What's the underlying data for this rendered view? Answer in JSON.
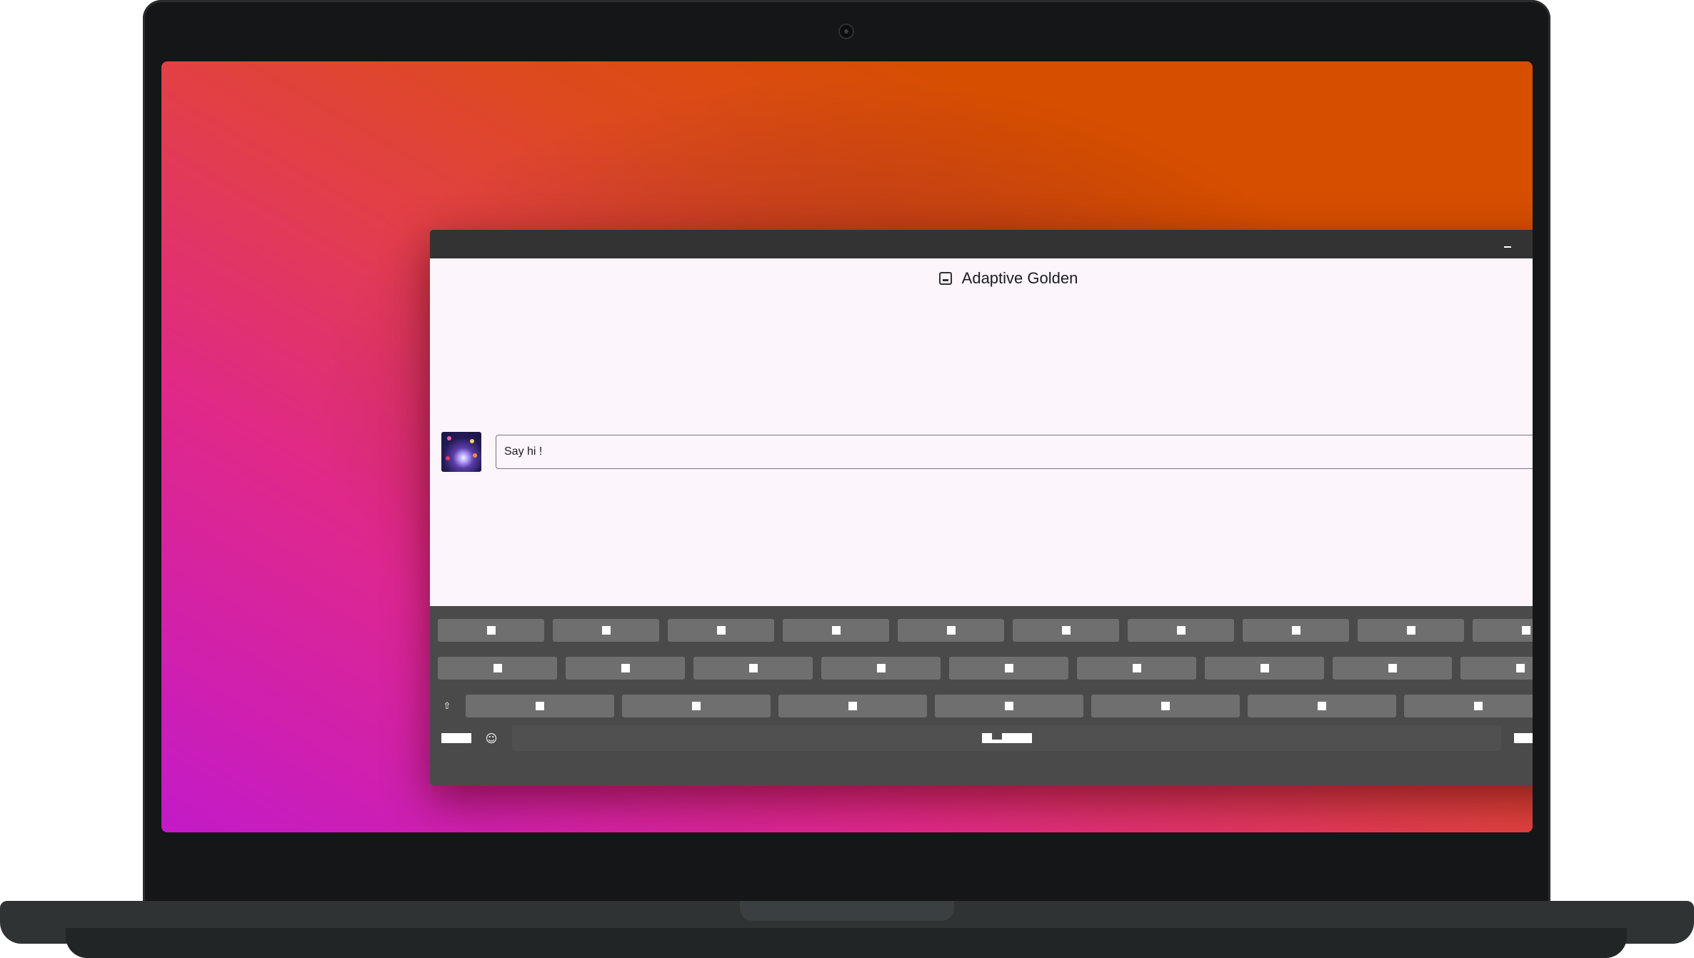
{
  "app": {
    "title": "Adaptive Golden"
  },
  "window_controls": {
    "minimize_icon": "minimize-icon",
    "maximize_icon": "maximize-icon",
    "close_icon": "close-icon",
    "close_color": "#e8552d"
  },
  "composer": {
    "placeholder": "Say hi !",
    "avatar_icon": "avatar-image"
  },
  "keyboard": {
    "row1_count": 10,
    "row2_count": 9,
    "row3_count": 7,
    "shift_glyph": "⇧",
    "backspace_glyph": "⌫",
    "emoji_glyph": "☺"
  },
  "colors": {
    "window_bg": "#fcf5fc",
    "titlebar": "#333333",
    "keyboard_bg": "#4a4a4a",
    "key_bg": "#6f6f6f",
    "wallpaper_start": "#c31ac8",
    "wallpaper_end": "#d64e00"
  }
}
